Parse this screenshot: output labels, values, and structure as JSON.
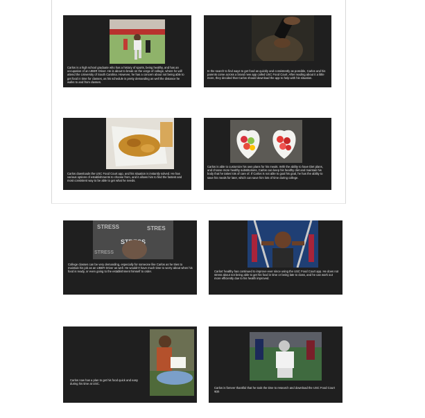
{
  "slides": [
    {
      "caption": "Carlos is a high school graduate who has a history of sports, being healthy, and has an occupation of an UBER Driver. He is about to break on the verge of college, where he will attend the University of South Carolina. However, he has a concern about not being able to get food in time for classes, as his schedule is pretty demanding as well the distance he walks to and from classes.",
      "image": "football-player-photo"
    },
    {
      "caption": "In the search to find ways to get food as quickly and consistently as possible, Carlos and his parents come across a brand new app called USC Food Court. After reading about it a little more, they decided that Carlos should download the app to help with his situation.",
      "image": "phone-in-hand-photo"
    },
    {
      "caption": "Carlos downloads the USC Food Court app, and his situation is instantly solved. He has various options of establishments to choose from, and it allows him to find the fastest and most consistent way to be able to get what he needs.",
      "image": "takeout-food-photo"
    },
    {
      "caption": "Carlos is able to customize his own plans for his meals. With the ability to have Diet plans, and choose more healthy substitutions, Carlos can keep his healthy diet and maintain his body that he takes lots of care of. If Carlos is not able to goal his goal, he has the ability to save his meals for later, which can save him lots of time during college.",
      "image": "fruit-bowls-photo"
    },
    {
      "caption": "College classes can be very demanding, especially for someone like Carlos as he tries to maintain his job as an UBER Driver as well. He wouldn't have much time to worry about when his food is ready, or even going to the establishment himself to order.",
      "image": "stress-photo"
    },
    {
      "caption": "Carlos' healthy has continued to improve ever since using the USC Food Court app. He does not stress about not being able to get his food in time or being late to class, and he can work out more efficiently due to his health improved.",
      "image": "gym-workout-photo"
    },
    {
      "caption": "Carlos now has a plan to get his food quick and easy during his time at USC.",
      "image": "student-reading-photo"
    },
    {
      "caption": "Carlos is forever thankful that he took the time to research and download the USC Food Court app.",
      "image": "football-kneeling-photo"
    }
  ]
}
